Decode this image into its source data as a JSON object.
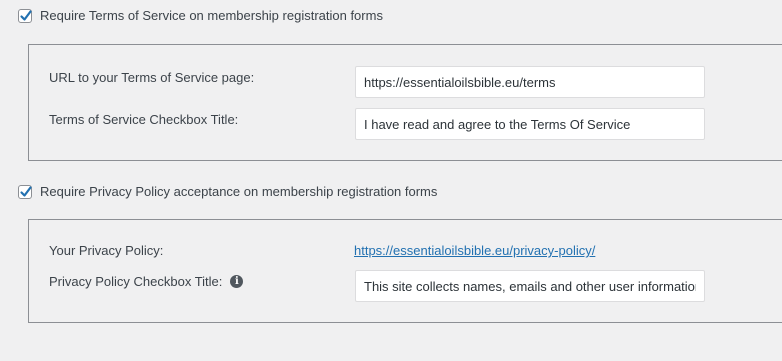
{
  "terms": {
    "checkbox_label": "Require Terms of Service on membership registration forms",
    "checked": true,
    "url_label": "URL to your Terms of Service page:",
    "url_value": "https://essentialoilsbible.eu/terms",
    "title_label": "Terms of Service Checkbox Title:",
    "title_value": "I have read and agree to the Terms Of Service"
  },
  "privacy": {
    "checkbox_label": "Require Privacy Policy acceptance on membership registration forms",
    "checked": true,
    "policy_label": "Your Privacy Policy:",
    "policy_link": "https://essentialoilsbible.eu/privacy-policy/",
    "title_label": "Privacy Policy Checkbox Title:",
    "title_value": "This site collects names, emails and other user information",
    "info_icon": "info-icon"
  },
  "colors": {
    "accent": "#2271b1",
    "background": "#f0f0f1",
    "border": "#8c8f94"
  }
}
